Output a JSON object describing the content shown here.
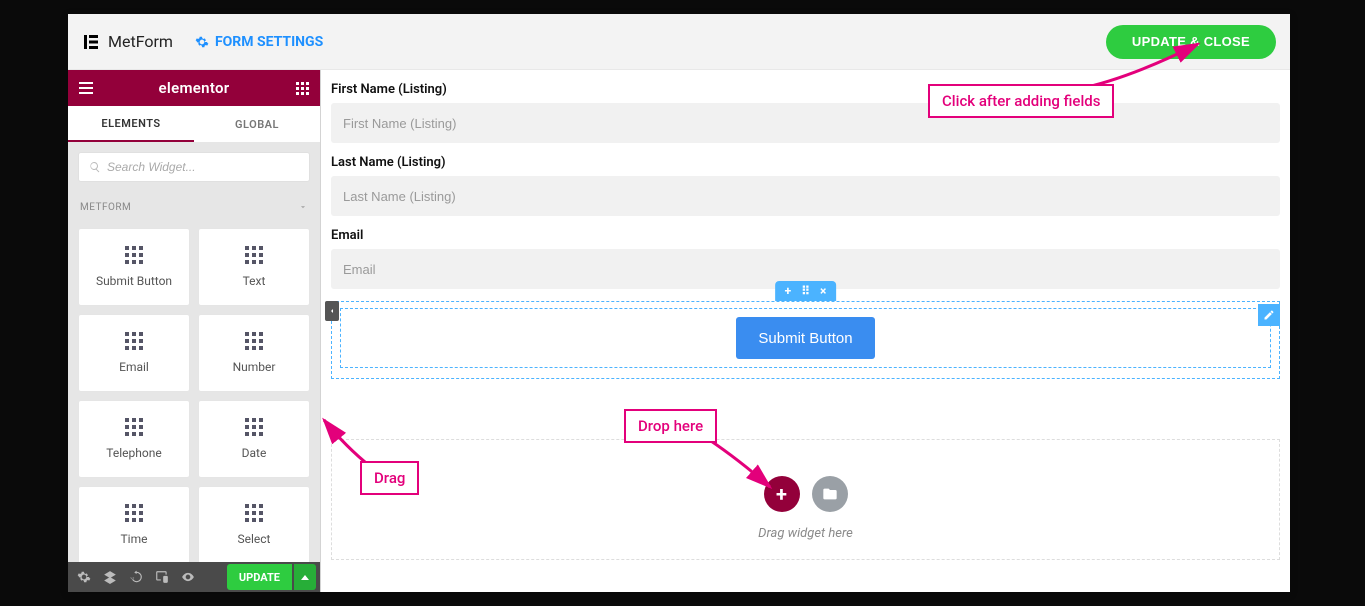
{
  "topbar": {
    "brand": "MetForm",
    "form_settings_label": "FORM SETTINGS",
    "update_close_label": "UPDATE & CLOSE"
  },
  "sidebar": {
    "title": "elementor",
    "tabs": {
      "elements": "ELEMENTS",
      "global": "GLOBAL"
    },
    "search_placeholder": "Search Widget...",
    "category_label": "METFORM",
    "widgets": [
      "Submit Button",
      "Text",
      "Email",
      "Number",
      "Telephone",
      "Date",
      "Time",
      "Select"
    ],
    "footer_update": "UPDATE"
  },
  "canvas": {
    "fields": [
      {
        "label": "First Name (Listing)",
        "placeholder": "First Name (Listing)"
      },
      {
        "label": "Last Name (Listing)",
        "placeholder": "Last Name (Listing)"
      },
      {
        "label": "Email",
        "placeholder": "Email"
      }
    ],
    "submit_label": "Submit Button",
    "section_tabs": {
      "add": "+",
      "move": "⠿",
      "close": "×"
    },
    "drop_hint": "Drag widget here"
  },
  "annotations": {
    "click_after": "Click after adding fields",
    "drag": "Drag",
    "drop": "Drop here"
  }
}
